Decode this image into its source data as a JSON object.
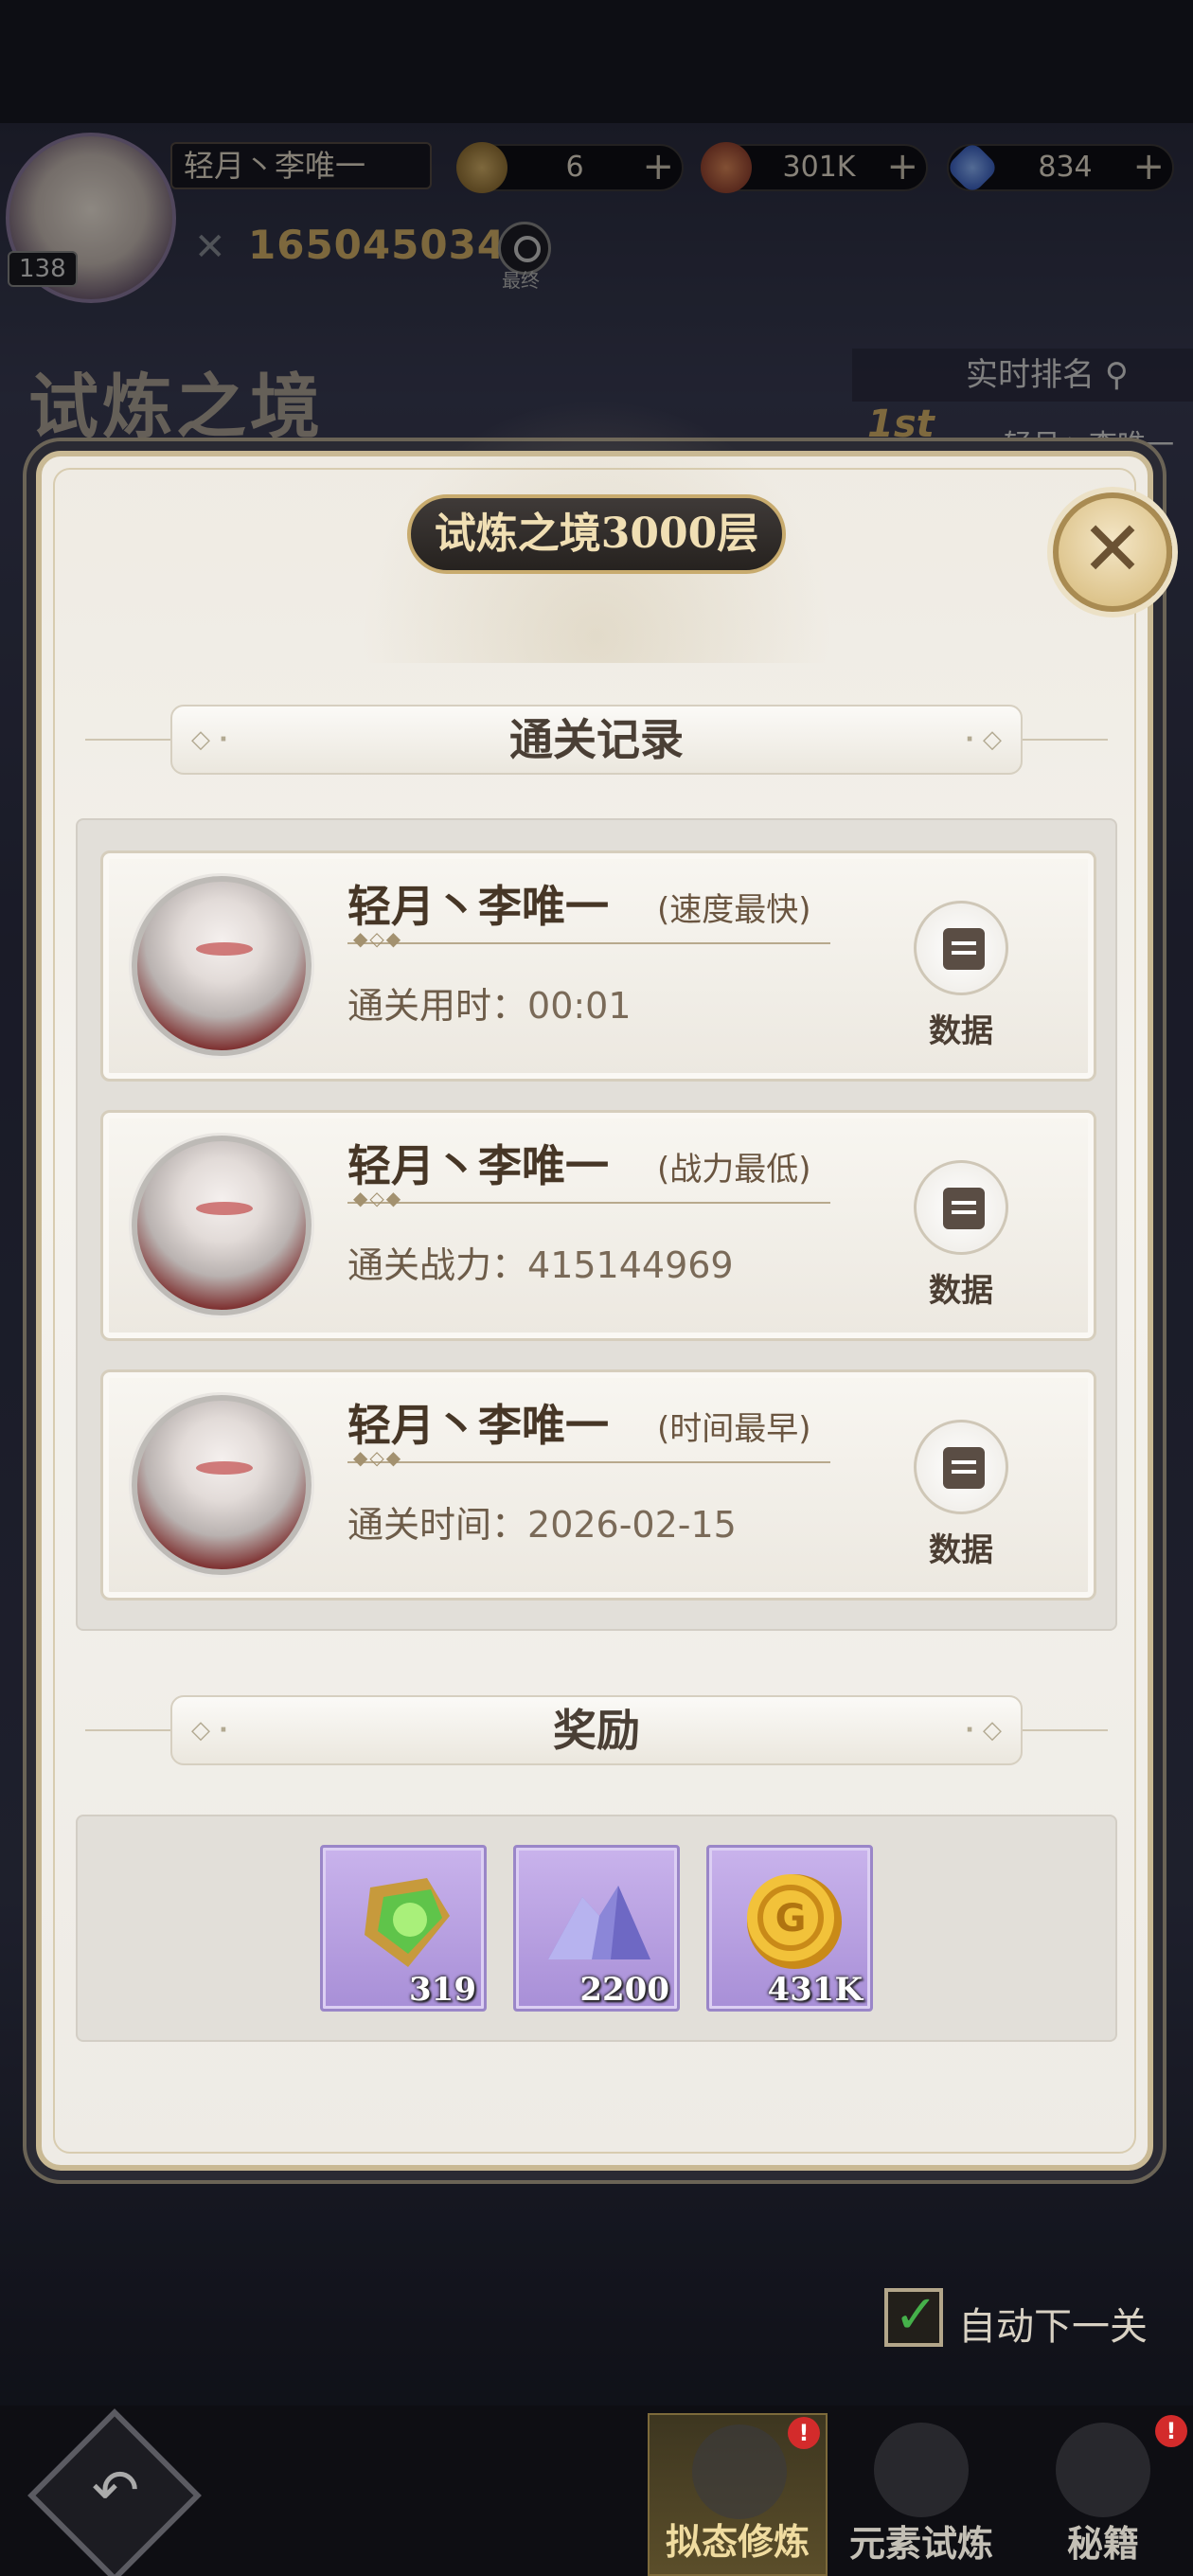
{
  "hud": {
    "player_name": "轻月丶李唯一",
    "level": "138",
    "resources": [
      {
        "icon": "stamina-coin-icon",
        "value": "6",
        "color": "#b48a3a"
      },
      {
        "icon": "gold-medal-icon",
        "value": "301K",
        "color": "#a04040"
      },
      {
        "icon": "diamond-icon",
        "value": "834",
        "color": "#3c6fd8"
      }
    ],
    "power": "165045034",
    "search_label": "最终"
  },
  "background": {
    "stage_title": "试炼之境",
    "rank_label": "实时排名",
    "rank_first": "1st",
    "rank_name": "轻月丶李唯一",
    "auto_next_label": "自动下一关",
    "auto_next_checked": true
  },
  "dialog": {
    "title": "试炼之境3000层",
    "clear_section": "通关记录",
    "reward_section": "奖励",
    "records": [
      {
        "name": "轻月丶李唯一",
        "tag": "(速度最快)",
        "label": "通关用时：",
        "value": "00:01",
        "data_label": "数据"
      },
      {
        "name": "轻月丶李唯一",
        "tag": "(战力最低)",
        "label": "通关战力：",
        "value": "415144969",
        "data_label": "数据"
      },
      {
        "name": "轻月丶李唯一",
        "tag": "(时间最早)",
        "label": "通关时间：",
        "value": "2026-02-15",
        "data_label": "数据"
      }
    ],
    "rewards": [
      {
        "icon": "green-gem-icon",
        "qty": "319"
      },
      {
        "icon": "crystal-dust-icon",
        "qty": "2200"
      },
      {
        "icon": "gold-coin-icon",
        "qty": "431K"
      }
    ]
  },
  "bottom_tabs": [
    {
      "label": "拟态修炼",
      "badge": "!"
    },
    {
      "label": "元素试炼",
      "badge": ""
    },
    {
      "label": "秘籍",
      "badge": "!"
    }
  ]
}
